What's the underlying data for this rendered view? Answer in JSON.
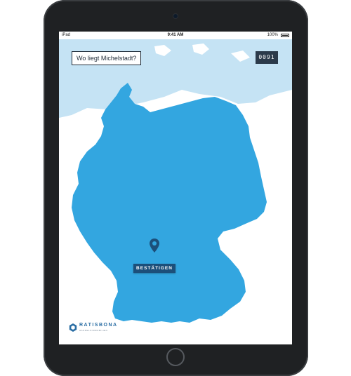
{
  "device": {
    "type": "iPad"
  },
  "status_bar": {
    "carrier": "iPad",
    "time": "9:41 AM",
    "battery": "100%"
  },
  "game": {
    "question": "Wo liegt Michelstadt?",
    "counter": "0091",
    "confirm_label": "BESTÄTIGEN",
    "pin_icon": "map-pin-icon"
  },
  "brand": {
    "name": "RATISBONA",
    "tagline": "HANDELSIMMOBILIEN",
    "logo_icon": "hexagon-logo-icon"
  },
  "colors": {
    "land": "#33a6e0",
    "sea": "#c5e3f4",
    "pin": "#1c4f7a",
    "button": "#1c4f7a",
    "counter_bg": "#2b3a4a"
  }
}
